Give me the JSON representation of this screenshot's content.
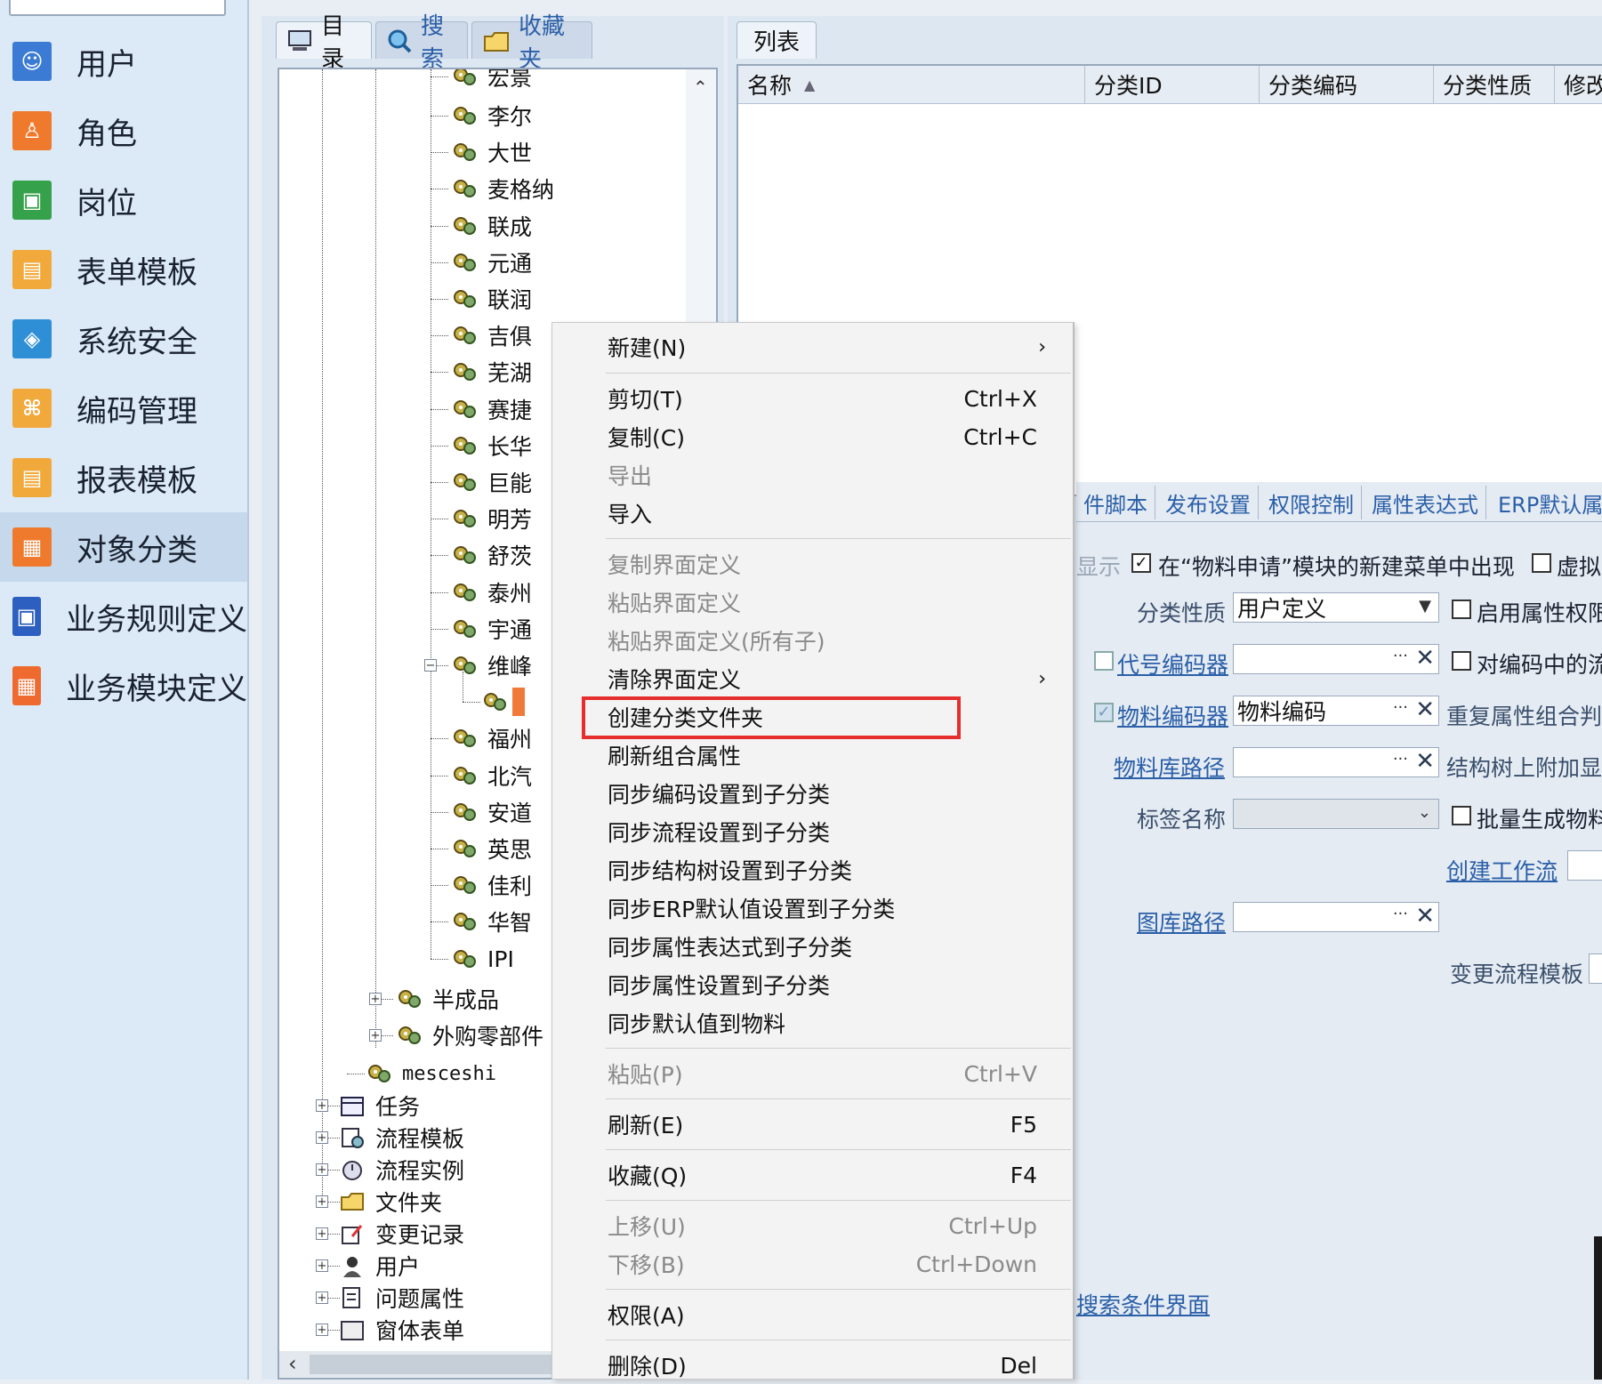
{
  "nav": {
    "items": [
      {
        "label": "用户",
        "color": "#3b7bd4",
        "icon": "user-icon"
      },
      {
        "label": "角色",
        "color": "#ef7a2e",
        "icon": "role-icon"
      },
      {
        "label": "岗位",
        "color": "#36a14b",
        "icon": "position-icon"
      },
      {
        "label": "表单模板",
        "color": "#f2a93b",
        "icon": "form-template-icon"
      },
      {
        "label": "系统安全",
        "color": "#2f8fd6",
        "icon": "security-icon"
      },
      {
        "label": "编码管理",
        "color": "#f2a93b",
        "icon": "code-icon"
      },
      {
        "label": "报表模板",
        "color": "#f2a93b",
        "icon": "report-icon"
      },
      {
        "label": "对象分类",
        "color": "#ef7a2e",
        "icon": "category-icon"
      },
      {
        "label": "业务规则定义",
        "color": "#2c5fbf",
        "icon": "rule-icon"
      },
      {
        "label": "业务模块定义",
        "color": "#ef6a2e",
        "icon": "module-icon"
      }
    ],
    "active_index": 7
  },
  "dir_tabs": {
    "catalog": "目录",
    "search": "搜索",
    "favorites": "收藏夹"
  },
  "tree": {
    "partial_top": "宏景",
    "items": [
      "李尔",
      "大世",
      "麦格纳",
      "联成",
      "元通",
      "联润",
      "吉俱",
      "芜湖",
      "赛捷",
      "长华",
      "巨能",
      "明芳",
      "舒茨",
      "泰州",
      "宇通",
      "维峰",
      "",
      "福州",
      "北汽",
      "安道",
      "英思",
      "佳利",
      "华智",
      "IPI"
    ],
    "level1": [
      "半成品",
      "外购零部件"
    ],
    "mesceshi": "mesceshi",
    "root_items": [
      "任务",
      "流程模板",
      "流程实例",
      "文件夹",
      "变更记录",
      "用户",
      "问题属性",
      "窗体表单"
    ]
  },
  "list": {
    "tab": "列表",
    "columns": [
      "名称",
      "分类ID",
      "分类编码",
      "分类性质",
      "修改"
    ]
  },
  "props": {
    "tabs": [
      "件脚本",
      "发布设置",
      "权限控制",
      "属性表达式",
      "ERP默认属性"
    ],
    "show_label_partial": "显示",
    "appear_in_menu": "在“物料申请”模块的新建菜单中出现",
    "virtual_partial": "虚拟",
    "category_nature_label": "分类性质",
    "category_nature_value": "用户定义",
    "enable_attr_permission": "启用属性权限",
    "code_encoder": "代号编码器",
    "encoding_flow": "对编码中的流",
    "material_encoder": "物料编码器",
    "material_encoder_value": "物料编码",
    "duplicate_check": "重复属性组合判断",
    "material_lib_path": "物料库路径",
    "structure_tree_append": "结构树上附加显示",
    "tag_name": "标签名称",
    "batch_generate": "批量生成物料",
    "create_workflow": "创建工作流",
    "drawing_lib_path": "图库路径",
    "change_flow_template": "变更流程模板",
    "search_condition_ui": "搜索条件界面"
  },
  "context_menu": {
    "new": "新建(N)",
    "cut": "剪切(T)",
    "cut_sc": "Ctrl+X",
    "copy": "复制(C)",
    "copy_sc": "Ctrl+C",
    "export": "导出",
    "import": "导入",
    "copy_ui": "复制界面定义",
    "paste_ui": "粘贴界面定义",
    "paste_ui_all": "粘贴界面定义(所有子)",
    "clear_ui": "清除界面定义",
    "create_folder": "创建分类文件夹",
    "refresh_combo": "刷新组合属性",
    "sync_code": "同步编码设置到子分类",
    "sync_flow": "同步流程设置到子分类",
    "sync_tree": "同步结构树设置到子分类",
    "sync_erp": "同步ERP默认值设置到子分类",
    "sync_expr": "同步属性表达式到子分类",
    "sync_attr": "同步属性设置到子分类",
    "sync_default": "同步默认值到物料",
    "paste": "粘贴(P)",
    "paste_sc": "Ctrl+V",
    "refresh": "刷新(E)",
    "refresh_sc": "F5",
    "favorite": "收藏(Q)",
    "favorite_sc": "F4",
    "move_up": "上移(U)",
    "move_up_sc": "Ctrl+Up",
    "move_down": "下移(B)",
    "move_down_sc": "Ctrl+Down",
    "permission": "权限(A)",
    "delete": "删除(D)",
    "delete_sc": "Del"
  },
  "colors": {
    "highlight": "#e62e2e",
    "link": "#2b5fa8"
  }
}
